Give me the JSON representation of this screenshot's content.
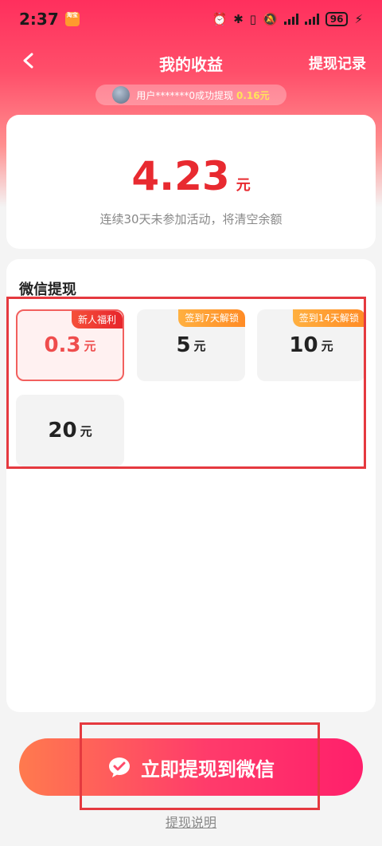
{
  "status_bar": {
    "time": "2:37",
    "app_badge": "淘宝",
    "battery": "96"
  },
  "header": {
    "title": "我的收益",
    "history_link": "提现记录"
  },
  "ticker": {
    "text": "用户*******0成功提现",
    "amount": "0.16元"
  },
  "balance": {
    "value": "4.23",
    "unit": "元",
    "note": "连续30天未参加活动，将清空余额"
  },
  "withdraw": {
    "title": "微信提现",
    "options": [
      {
        "amount": "0.3",
        "unit": "元",
        "tag": "新人福利",
        "tag_color": "red",
        "selected": true
      },
      {
        "amount": "5",
        "unit": "元",
        "tag": "签到7天解锁",
        "tag_color": "orange",
        "selected": false
      },
      {
        "amount": "10",
        "unit": "元",
        "tag": "签到14天解锁",
        "tag_color": "orange",
        "selected": false
      },
      {
        "amount": "20",
        "unit": "元",
        "tag": "",
        "tag_color": "",
        "selected": false
      }
    ]
  },
  "action": {
    "button_label": "立即提现到微信",
    "help_link": "提现说明"
  },
  "colors": {
    "accent_red": "#e82a30",
    "selected_border": "#f2605e",
    "button_gradient_start": "#ff7a4e",
    "button_gradient_end": "#ff1f6b"
  }
}
